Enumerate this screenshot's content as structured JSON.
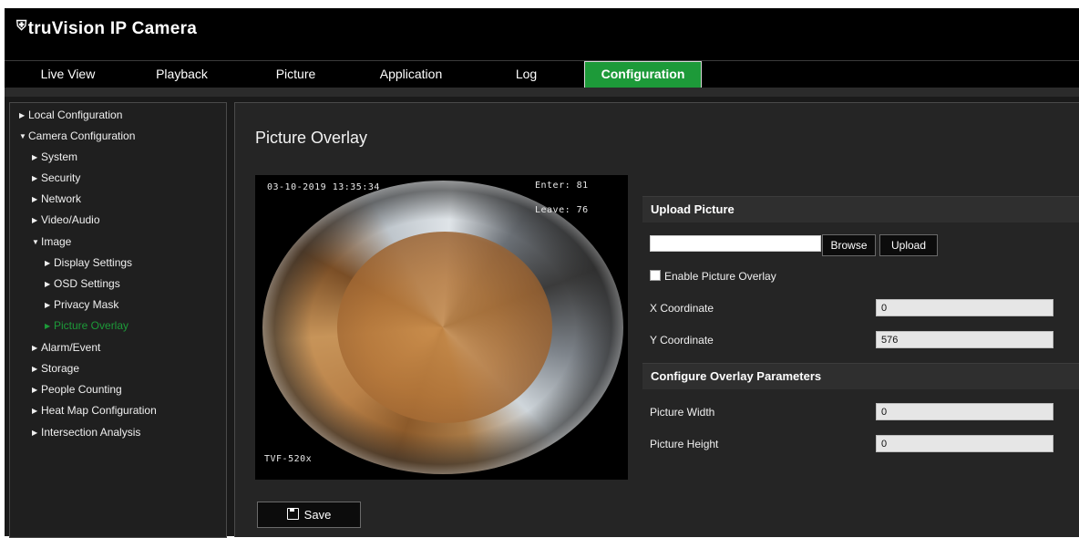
{
  "app": {
    "logo_glyph": "⛨",
    "title": "truVision  IP Camera"
  },
  "nav": {
    "items": [
      {
        "label": "Live View"
      },
      {
        "label": "Playback"
      },
      {
        "label": "Picture"
      },
      {
        "label": "Application"
      },
      {
        "label": "Log"
      },
      {
        "label": "Configuration"
      }
    ],
    "active": "Configuration",
    "accent_color": "#1d9a39"
  },
  "sidebar": {
    "items": [
      {
        "label": "Local Configuration",
        "expanded": false
      },
      {
        "label": "Camera Configuration",
        "expanded": true
      },
      {
        "label": "System",
        "expanded": false
      },
      {
        "label": "Security",
        "expanded": false
      },
      {
        "label": "Network",
        "expanded": false
      },
      {
        "label": "Video/Audio",
        "expanded": false
      },
      {
        "label": "Image",
        "expanded": true
      },
      {
        "label": "Display Settings",
        "expanded": false
      },
      {
        "label": "OSD Settings",
        "expanded": false
      },
      {
        "label": "Privacy Mask",
        "expanded": false
      },
      {
        "label": "Picture Overlay",
        "expanded": false,
        "active": true
      },
      {
        "label": "Alarm/Event",
        "expanded": false
      },
      {
        "label": "Storage",
        "expanded": false
      },
      {
        "label": "People Counting",
        "expanded": false
      },
      {
        "label": "Heat Map Configuration",
        "expanded": false
      },
      {
        "label": "Intersection Analysis",
        "expanded": false
      }
    ]
  },
  "main": {
    "title": "Picture Overlay",
    "preview": {
      "datetime": "03-10-2019 13:35:34",
      "enter": "Enter: 81",
      "leave": "Leave: 76",
      "camera_name": "TVF-520x"
    },
    "save_label": "Save",
    "upload": {
      "header": "Upload Picture",
      "file_value": "",
      "browse_label": "Browse",
      "upload_label": "Upload",
      "enable_label": "Enable Picture Overlay",
      "enable_checked": false,
      "x_label": "X Coordinate",
      "x_value": "0",
      "y_label": "Y Coordinate",
      "y_value": "576"
    },
    "params": {
      "header": "Configure Overlay Parameters",
      "width_label": "Picture Width",
      "width_value": "0",
      "height_label": "Picture Height",
      "height_value": "0"
    }
  }
}
